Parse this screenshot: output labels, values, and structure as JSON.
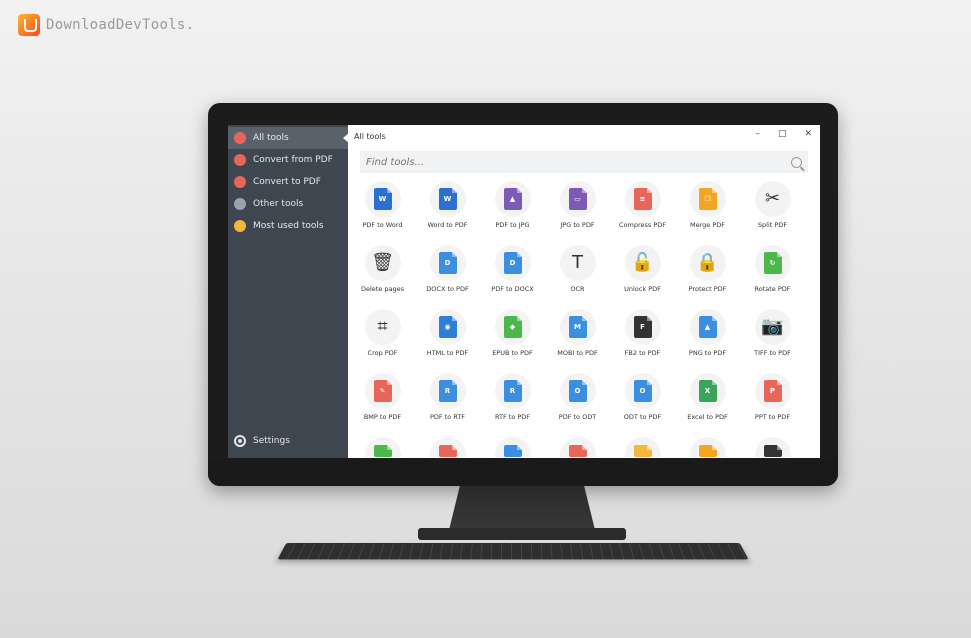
{
  "watermark": {
    "text": "DownloadDevTools."
  },
  "window": {
    "title": "All tools",
    "controls": [
      "–",
      "□",
      "✕"
    ]
  },
  "search": {
    "placeholder": "Find tools..."
  },
  "sidebar": {
    "items": [
      {
        "label": "All tools",
        "color": "#e8655a",
        "icon": "circle-icon"
      },
      {
        "label": "Convert from PDF",
        "color": "#e8655a",
        "icon": "arrow-down-icon"
      },
      {
        "label": "Convert to PDF",
        "color": "#e8655a",
        "icon": "arrow-up-icon"
      },
      {
        "label": "Other tools",
        "color": "#9aa3ad",
        "icon": "more-icon"
      },
      {
        "label": "Most used tools",
        "color": "#f4b63c",
        "icon": "star-icon"
      }
    ],
    "settings": "Settings"
  },
  "tools": [
    {
      "label": "PDF to Word",
      "icon": "pdf-to-word-icon",
      "color": "#2b6fd1",
      "glyph": "W"
    },
    {
      "label": "Word to PDF",
      "icon": "word-to-pdf-icon",
      "color": "#2b6fd1",
      "glyph": "W"
    },
    {
      "label": "PDF to JPG",
      "icon": "pdf-to-jpg-icon",
      "color": "#7b5bb6",
      "glyph": "▲"
    },
    {
      "label": "JPG to PDF",
      "icon": "jpg-to-pdf-icon",
      "color": "#7b5bb6",
      "glyph": "▭"
    },
    {
      "label": "Compress PDF",
      "icon": "compress-icon",
      "color": "#e8655a",
      "glyph": "≡"
    },
    {
      "label": "Merge PDF",
      "icon": "merge-icon",
      "color": "#f4a623",
      "glyph": "❐"
    },
    {
      "label": "Split PDF",
      "icon": "scissors-icon",
      "color": "",
      "glyph": "✂"
    },
    {
      "label": "Delete pages",
      "icon": "trash-icon",
      "color": "",
      "glyph": "🗑"
    },
    {
      "label": "DOCX to PDF",
      "icon": "docx-to-pdf-icon",
      "color": "#3a8fe0",
      "glyph": "D"
    },
    {
      "label": "PDF to DOCX",
      "icon": "pdf-to-docx-icon",
      "color": "#3a8fe0",
      "glyph": "D"
    },
    {
      "label": "OCR",
      "icon": "ocr-icon",
      "color": "",
      "glyph": "T"
    },
    {
      "label": "Unlock PDF",
      "icon": "unlock-icon",
      "color": "",
      "glyph": "🔓"
    },
    {
      "label": "Protect PDF",
      "icon": "lock-icon",
      "color": "",
      "glyph": "🔒"
    },
    {
      "label": "Rotate PDF",
      "icon": "rotate-icon",
      "color": "#4cb84c",
      "glyph": "↻"
    },
    {
      "label": "Crop PDF",
      "icon": "crop-icon",
      "color": "",
      "glyph": "⌗"
    },
    {
      "label": "HTML to PDF",
      "icon": "globe-icon",
      "color": "#2b7fd6",
      "glyph": "◉"
    },
    {
      "label": "EPUB to PDF",
      "icon": "epub-icon",
      "color": "#4cb84c",
      "glyph": "◆"
    },
    {
      "label": "MOBI to PDF",
      "icon": "mobi-icon",
      "color": "#3a8fe0",
      "glyph": "M"
    },
    {
      "label": "FB2 to PDF",
      "icon": "fb2-icon",
      "color": "#333333",
      "glyph": "F"
    },
    {
      "label": "PNG to PDF",
      "icon": "png-icon",
      "color": "#3a8fe0",
      "glyph": "▲"
    },
    {
      "label": "TIFF to PDF",
      "icon": "camera-icon",
      "color": "",
      "glyph": "📷"
    },
    {
      "label": "BMP to PDF",
      "icon": "brush-icon",
      "color": "#e8655a",
      "glyph": "✎"
    },
    {
      "label": "PDF to RTF",
      "icon": "pdf-to-rtf-icon",
      "color": "#3a8fe0",
      "glyph": "R"
    },
    {
      "label": "RTF to PDF",
      "icon": "rtf-to-pdf-icon",
      "color": "#3a8fe0",
      "glyph": "R"
    },
    {
      "label": "PDF to ODT",
      "icon": "pdf-to-odt-icon",
      "color": "#3a8fe0",
      "glyph": "O"
    },
    {
      "label": "ODT to PDF",
      "icon": "odt-to-pdf-icon",
      "color": "#3a8fe0",
      "glyph": "O"
    },
    {
      "label": "Excel to PDF",
      "icon": "excel-icon",
      "color": "#3aa55a",
      "glyph": "X"
    },
    {
      "label": "PPT to PDF",
      "icon": "ppt-icon",
      "color": "#e8655a",
      "glyph": "P"
    },
    {
      "label": "",
      "icon": "tool-icon",
      "color": "#4cb84c",
      "glyph": ""
    },
    {
      "label": "",
      "icon": "tool-icon",
      "color": "#e8655a",
      "glyph": ""
    },
    {
      "label": "",
      "icon": "tool-icon",
      "color": "#3a8fe0",
      "glyph": ""
    },
    {
      "label": "",
      "icon": "tool-icon",
      "color": "#e8655a",
      "glyph": ""
    },
    {
      "label": "",
      "icon": "tool-icon",
      "color": "#f4b63c",
      "glyph": ""
    },
    {
      "label": "",
      "icon": "tool-icon",
      "color": "#f4a623",
      "glyph": ""
    },
    {
      "label": "",
      "icon": "tool-icon",
      "color": "#333333",
      "glyph": ""
    }
  ]
}
